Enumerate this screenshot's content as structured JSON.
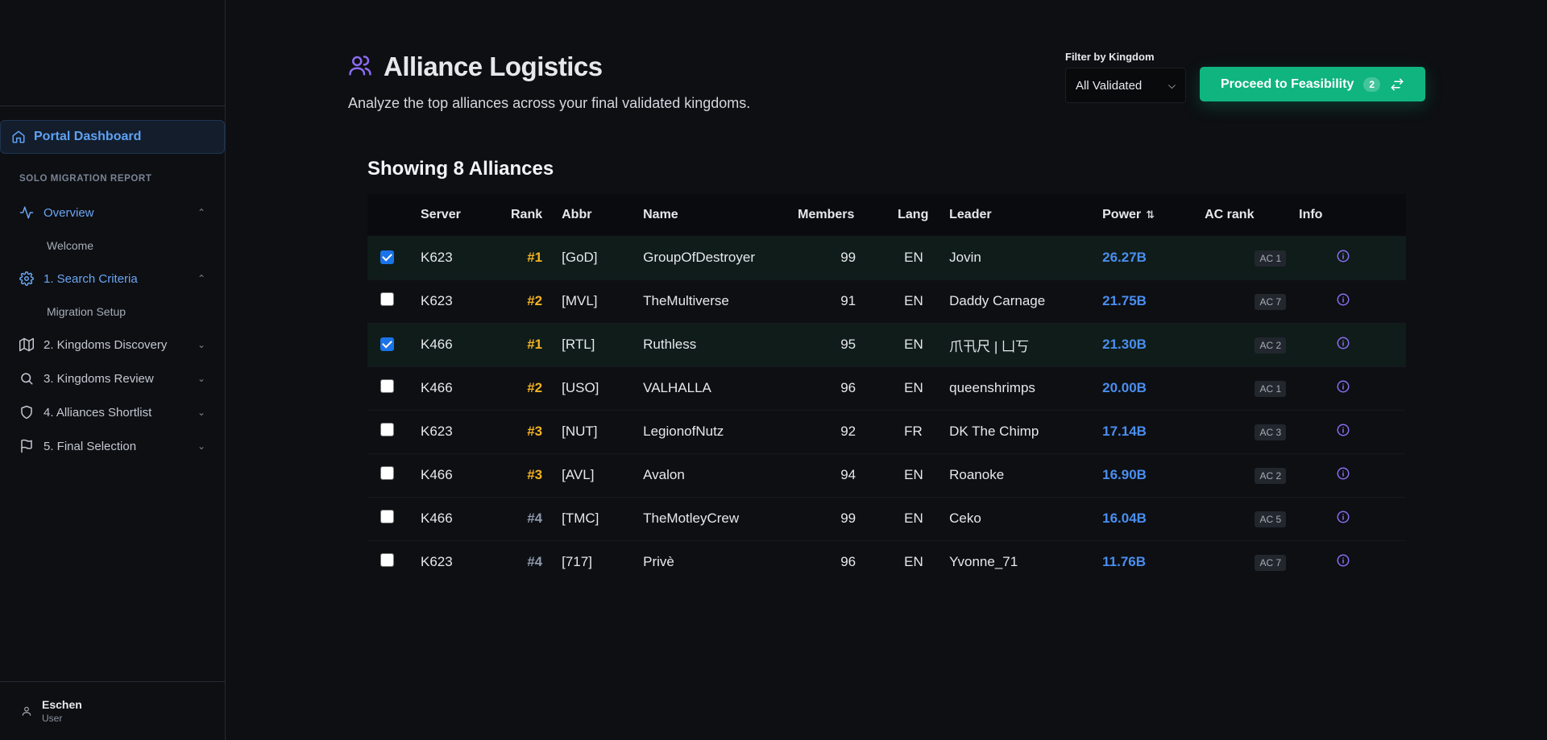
{
  "sidebar": {
    "portal_label": "Portal Dashboard",
    "section_label": "SOLO MIGRATION REPORT",
    "items": [
      {
        "label": "Overview",
        "icon": "activity-icon",
        "active": true,
        "sub": "Welcome"
      },
      {
        "label": "1. Search Criteria",
        "icon": "gear-icon",
        "active": true,
        "sub": "Migration Setup"
      },
      {
        "label": "2. Kingdoms Discovery",
        "icon": "map-icon",
        "active": false
      },
      {
        "label": "3. Kingdoms Review",
        "icon": "search-icon",
        "active": false
      },
      {
        "label": "4. Alliances Shortlist",
        "icon": "shield-icon",
        "active": false
      },
      {
        "label": "5. Final Selection",
        "icon": "flag-icon",
        "active": false
      }
    ],
    "user": {
      "name": "Eschen",
      "role": "User"
    }
  },
  "header": {
    "title": "Alliance Logistics",
    "subtitle": "Analyze the top alliances across your final validated kingdoms.",
    "filter_label": "Filter by Kingdom",
    "filter_value": "All Validated",
    "proceed_label": "Proceed to Feasibility",
    "proceed_count": "2"
  },
  "table": {
    "showing": "Showing 8 Alliances",
    "columns": [
      "Server",
      "Rank",
      "Abbr",
      "Name",
      "Members",
      "Lang",
      "Leader",
      "Power",
      "AC rank",
      "Info"
    ],
    "rows": [
      {
        "checked": true,
        "server": "K623",
        "rank": "#1",
        "abbr": "[GoD]",
        "name": "GroupOfDestroyer",
        "members": "99",
        "lang": "EN",
        "leader": "Jovin",
        "power": "26.27B",
        "ac": "AC 1"
      },
      {
        "checked": false,
        "server": "K623",
        "rank": "#2",
        "abbr": "[MVL]",
        "name": "TheMultiverse",
        "members": "91",
        "lang": "EN",
        "leader": "Daddy Carnage",
        "power": "21.75B",
        "ac": "AC 7"
      },
      {
        "checked": true,
        "server": "K466",
        "rank": "#1",
        "abbr": "[RTL]",
        "name": "Ruthless",
        "members": "95",
        "lang": "EN",
        "leader": "爪卂尺 | 凵丂",
        "power": "21.30B",
        "ac": "AC 2"
      },
      {
        "checked": false,
        "server": "K466",
        "rank": "#2",
        "abbr": "[USO]",
        "name": "VALHALLA",
        "members": "96",
        "lang": "EN",
        "leader": "queenshrimps",
        "power": "20.00B",
        "ac": "AC 1"
      },
      {
        "checked": false,
        "server": "K623",
        "rank": "#3",
        "abbr": "[NUT]",
        "name": "LegionofNutz",
        "members": "92",
        "lang": "FR",
        "leader": "DK The Chimp",
        "power": "17.14B",
        "ac": "AC 3"
      },
      {
        "checked": false,
        "server": "K466",
        "rank": "#3",
        "abbr": "[AVL]",
        "name": "Avalon",
        "members": "94",
        "lang": "EN",
        "leader": "Roanoke",
        "power": "16.90B",
        "ac": "AC 2"
      },
      {
        "checked": false,
        "server": "K466",
        "rank": "#4",
        "abbr": "[TMC]",
        "name": "TheMotleyCrew",
        "members": "99",
        "lang": "EN",
        "leader": "Ceko",
        "power": "16.04B",
        "ac": "AC 5"
      },
      {
        "checked": false,
        "server": "K623",
        "rank": "#4",
        "abbr": "[717]",
        "name": "Privè",
        "members": "96",
        "lang": "EN",
        "leader": "Yvonne_71",
        "power": "11.76B",
        "ac": "AC 7"
      }
    ]
  },
  "colors": {
    "accent_blue": "#5ea2f3",
    "proceed_green": "#10b47e",
    "rank_gold": "#f3b223",
    "power_blue": "#4a8ef0",
    "info_purple": "#8b6cf0"
  }
}
